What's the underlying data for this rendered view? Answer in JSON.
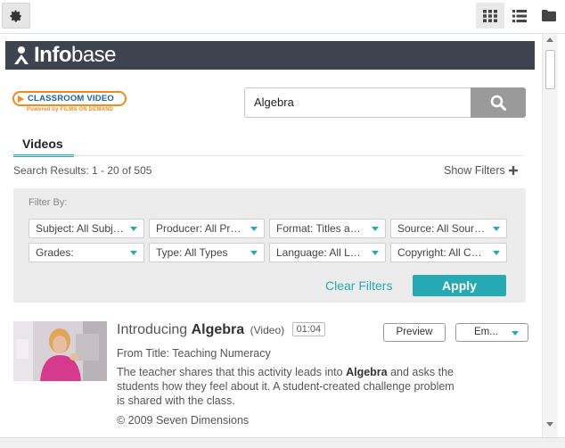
{
  "toolbar": {
    "settings_icon": "gear-icon",
    "grid_icon": "grid-view-icon",
    "list_icon": "list-view-icon",
    "folder_icon": "folder-icon"
  },
  "brand": {
    "logo_bold": "Info",
    "logo_light": "base",
    "bar_color": "#3d4450"
  },
  "product_logo": {
    "main": "CLASSROOM VIDEO",
    "sub": "Powered by FILMS ON DEMAND"
  },
  "search": {
    "value": "Algebra",
    "button_icon": "search-icon"
  },
  "tabs": [
    {
      "label": "Videos",
      "active": true
    }
  ],
  "results": {
    "summary": "Search Results: 1 - 20 of 505",
    "show_filters": "Show Filters",
    "show_filters_icon": "plus-icon"
  },
  "filters": {
    "heading": "Filter By:",
    "selects": [
      {
        "label": "Subject: All Subjects"
      },
      {
        "label": "Producer: All Producers"
      },
      {
        "label": "Format: Titles and Segments"
      },
      {
        "label": "Source: All Sources"
      },
      {
        "label": "Grades:"
      },
      {
        "label": "Type: All Types"
      },
      {
        "label": "Language: All Languages"
      },
      {
        "label": "Copyright: All Copyrights"
      }
    ],
    "clear_label": "Clear Filters",
    "apply_label": "Apply",
    "accent_color": "#27a9b3"
  },
  "items": [
    {
      "title_prefix": "Introducing ",
      "title_bold": "Algebra",
      "type": "(Video)",
      "duration": "01:04",
      "preview_label": "Preview",
      "embed_label": "Em...",
      "from_title": "From Title: Teaching Numeracy",
      "desc_before": "The teacher shares that this activity leads into ",
      "desc_bold": "Algebra",
      "desc_after": " and asks the students how they feel about it. A student-created challenge problem is shared with the class.",
      "copyright": "© 2009 Seven Dimensions"
    }
  ]
}
